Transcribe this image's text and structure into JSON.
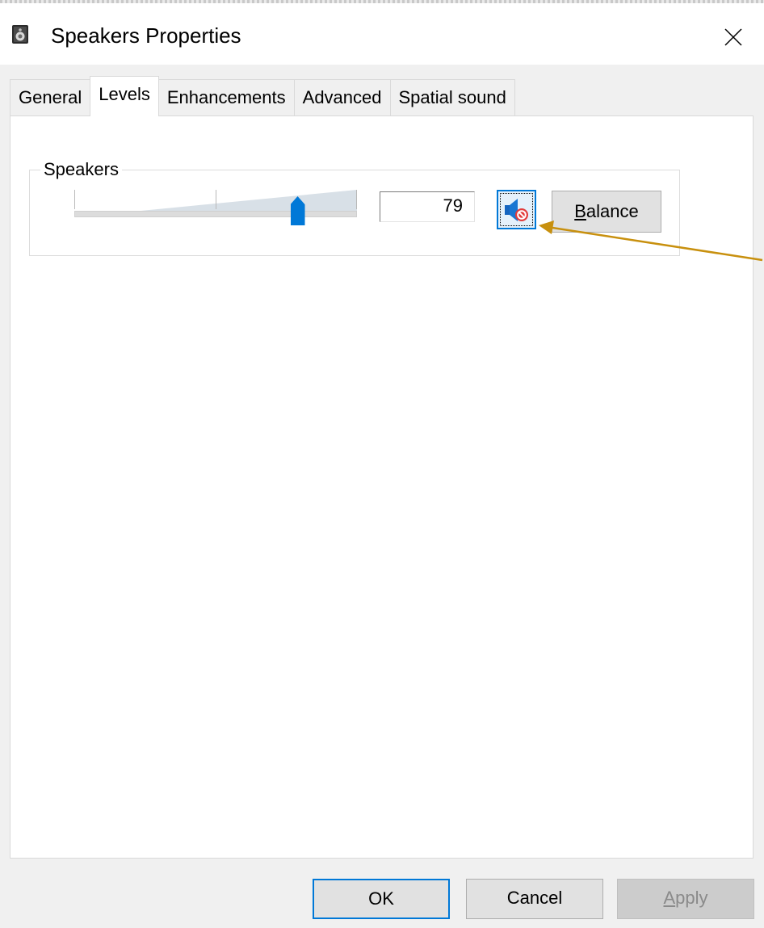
{
  "window": {
    "title": "Speakers Properties",
    "title_icon": "speaker-device-icon",
    "close_icon": "close-icon"
  },
  "tabs": [
    {
      "label": "General",
      "active": false
    },
    {
      "label": "Levels",
      "active": true
    },
    {
      "label": "Enhancements",
      "active": false
    },
    {
      "label": "Advanced",
      "active": false
    },
    {
      "label": "Spatial sound",
      "active": false
    }
  ],
  "levels": {
    "group_label": "Speakers",
    "volume_value": "79",
    "volume_fraction": 0.79,
    "mute_icon": "speaker-muted-icon",
    "balance_label_accel": "B",
    "balance_label_rest": "alance"
  },
  "footer": {
    "ok_label": "OK",
    "cancel_label": "Cancel",
    "apply_label_accel": "A",
    "apply_label_rest": "pply",
    "apply_enabled": false
  },
  "colors": {
    "accent": "#0078d7",
    "annotation_arrow": "#c8900e",
    "mute_badge": "#e23c3c"
  }
}
